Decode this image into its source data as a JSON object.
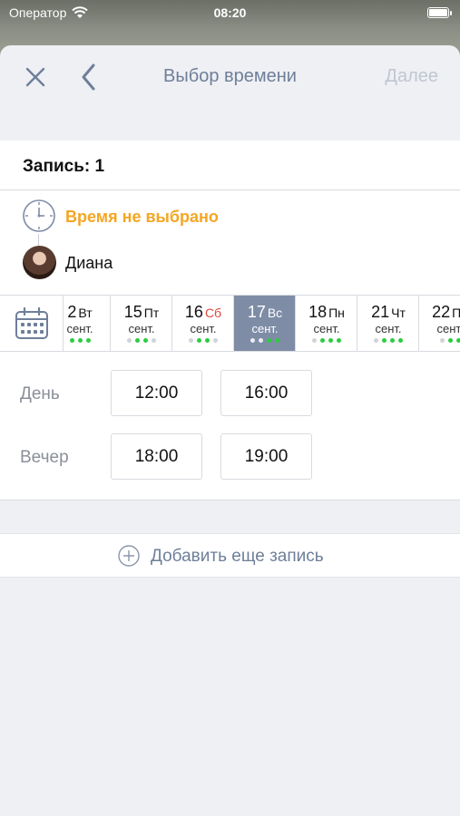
{
  "status_bar": {
    "carrier": "Оператор",
    "time": "08:20"
  },
  "nav": {
    "title": "Выбор времени",
    "next_label": "Далее"
  },
  "record": {
    "title": "Запись: 1",
    "time_status": "Время не выбрано",
    "master_name": "Диана"
  },
  "days": [
    {
      "num": "2",
      "weekday": "Вт",
      "month": "сент.",
      "dots": [
        "g",
        "g",
        "g"
      ]
    },
    {
      "num": "15",
      "weekday": "Пт",
      "month": "сент.",
      "dots": [
        "l",
        "g",
        "g",
        "l"
      ]
    },
    {
      "num": "16",
      "weekday": "Сб",
      "month": "сент.",
      "dots": [
        "l",
        "g",
        "g",
        "l"
      ]
    },
    {
      "num": "17",
      "weekday": "Вс",
      "month": "сент.",
      "dots": [
        "l",
        "l",
        "g",
        "g"
      ],
      "selected": true
    },
    {
      "num": "18",
      "weekday": "Пн",
      "month": "сент.",
      "dots": [
        "l",
        "g",
        "g",
        "g"
      ]
    },
    {
      "num": "21",
      "weekday": "Чт",
      "month": "сент.",
      "dots": [
        "l",
        "g",
        "g",
        "g"
      ]
    },
    {
      "num": "22",
      "weekday": "Пн",
      "month": "сент.",
      "dots": [
        "l",
        "g",
        "g"
      ]
    }
  ],
  "slots": {
    "day_label": "День",
    "evening_label": "Вечер",
    "day_times": [
      "12:00",
      "16:00"
    ],
    "evening_times": [
      "18:00",
      "19:00"
    ]
  },
  "add_record_label": "Добавить еще запись",
  "colors": {
    "accent": "#6e7f99",
    "warning": "#f5a623",
    "selected_day": "#7e8ca6",
    "available_dot": "#2ecc40",
    "weekend": "#e0443a"
  }
}
